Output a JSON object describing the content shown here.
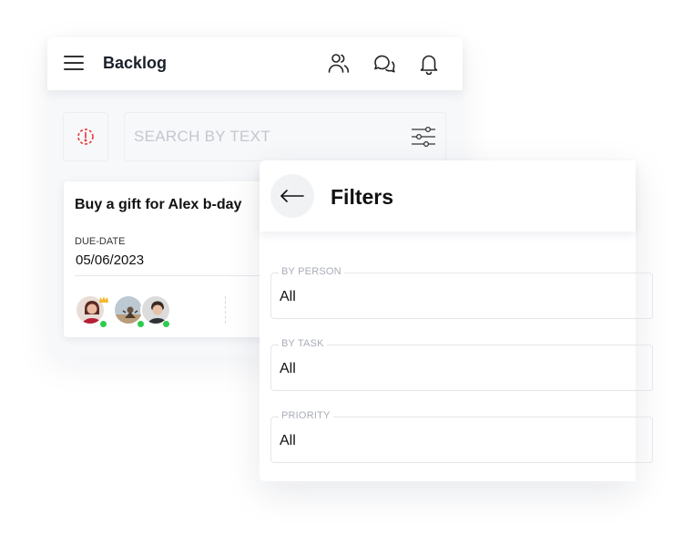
{
  "header": {
    "title": "Backlog"
  },
  "search": {
    "placeholder": "SEARCH BY TEXT"
  },
  "task": {
    "title": "Buy a gift for Alex b-day",
    "due_label": "DUE-DATE",
    "due_value": "05/06/2023"
  },
  "filters": {
    "title": "Filters",
    "fields": [
      {
        "label": "BY PERSON",
        "value": "All"
      },
      {
        "label": "BY TASK",
        "value": "All"
      },
      {
        "label": "PRIORITY",
        "value": "All"
      }
    ]
  },
  "colors": {
    "alert": "#e8413d",
    "online": "#2ecc4c",
    "crown": "#f5b82e"
  },
  "icons": [
    "menu-icon",
    "team-icon",
    "chat-icon",
    "bell-icon",
    "alert-icon",
    "filter-sliders-icon",
    "arrow-left-icon",
    "crown-icon"
  ]
}
